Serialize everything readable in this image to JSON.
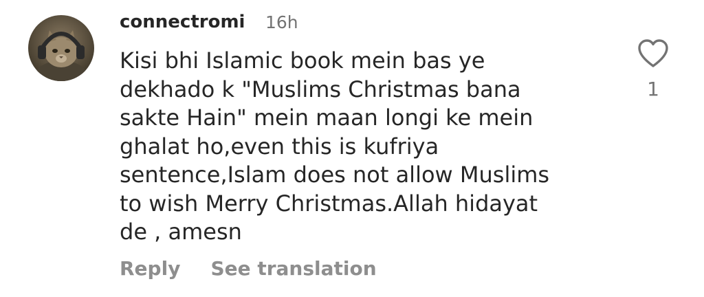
{
  "comment": {
    "avatar_icon": "cat-with-headphones-avatar",
    "username": "connectromi",
    "timestamp": "16h",
    "text_lines": [
      "Kisi bhi Islamic book mein bas ye",
      "dekhado k \"Muslims Christmas bana",
      "sakte Hain\" mein maan longi ke mein",
      "ghalat ho,even this is kufriya",
      "sentence,Islam does not allow Muslims",
      "to wish Merry Christmas.Allah hidayat",
      "de , amesn"
    ],
    "actions": {
      "reply_label": "Reply",
      "translate_label": "See translation"
    },
    "like": {
      "icon": "heart-outline-icon",
      "count": "1"
    }
  },
  "colors": {
    "primary_text": "#262626",
    "secondary_text": "#737373",
    "action_text": "#8e8e8e",
    "background": "#ffffff"
  }
}
